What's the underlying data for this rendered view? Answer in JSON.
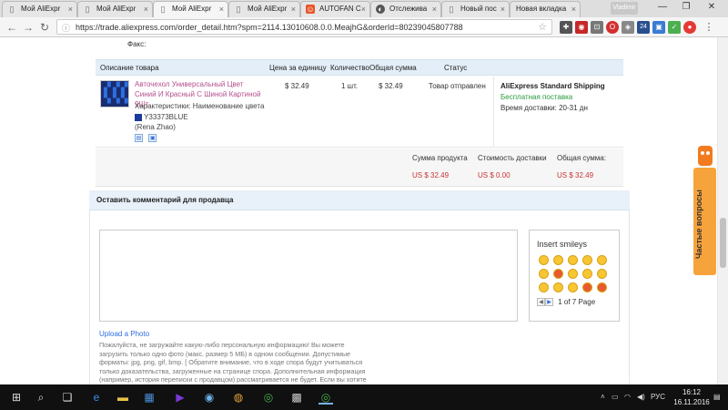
{
  "browser": {
    "tabs": [
      {
        "title": "Мой AliExpr",
        "icon": "document-icon",
        "active": false
      },
      {
        "title": "Мой AliExpr",
        "icon": "document-icon",
        "active": false
      },
      {
        "title": "Мой AliExpr",
        "icon": "document-icon",
        "active": true
      },
      {
        "title": "Мой AliExpr",
        "icon": "document-icon",
        "active": false
      },
      {
        "title": "AUTOFAN C",
        "icon": "autofan-icon",
        "active": false
      },
      {
        "title": "Отслежива",
        "icon": "tracking-icon",
        "active": false
      },
      {
        "title": "Новый пос",
        "icon": "document-icon",
        "active": false
      },
      {
        "title": "Новая вкладка",
        "icon": "none",
        "active": false
      }
    ],
    "user_label": "Vladimir",
    "url": "https://trade.aliexpress.com/order_detail.htm?spm=2114.13010608.0.0.MeajhG&orderId=80239045807788",
    "extension_badge": "24"
  },
  "order": {
    "fax_label": "Факс:",
    "columns": [
      "Описание товара",
      "Цена за единицу",
      "Количество",
      "Общая сумма",
      "Статус"
    ],
    "item": {
      "title": "Авточехол Универсальный Цвет Синий И Красный С Шиной Картиной 9Шт",
      "characteristics": "Характеристики: Наименование цвета",
      "color_code": "Y33373BLUE",
      "seller": "(Rena Zhao)",
      "unit_price": "$ 32.49",
      "quantity": "1 шт.",
      "total": "$ 32.49",
      "status": "Товар отправлен"
    },
    "shipping": {
      "method": "AliExpress Standard Shipping",
      "cost_text": "Бесплатная поставка",
      "delivery_time": "Время доставки: 20-31 дн"
    },
    "totals": {
      "product_label": "Сумма продукта",
      "product_value": "US $ 32.49",
      "shipping_label": "Стоимость доставки",
      "shipping_value": "US $ 0.00",
      "total_label": "Общая сумма:",
      "total_value": "US $ 32.49"
    }
  },
  "comment": {
    "header": "Оставить комментарий для продавца",
    "smileys_title": "Insert smileys",
    "pager_text": "1 of 7 Page",
    "upload_link": "Upload a Photo",
    "warning": "Пожалуйста, не загружайте какую-либо персональную информацию! Вы можете загрузить только одно фото (макс. размер 5 МБ) в одном сообщении. Допустимые форматы: jpg, png, gif, bmp. [ Обратите внимание, что в ходе спора будут учитываться только доказательства, загруженные на странице спора. Дополнительная информация (например, история переписки с продавцом) рассматривается не будет. Если вы хотите использовать историю переписки в качестве доказательства, пожалуйста, прикрепите соответствующие скриншоты на странице спора. ]"
  },
  "help_widget": {
    "label": "Частые вопросы"
  },
  "taskbar": {
    "language": "РУС",
    "time": "16:12",
    "date": "16.11.2016"
  }
}
